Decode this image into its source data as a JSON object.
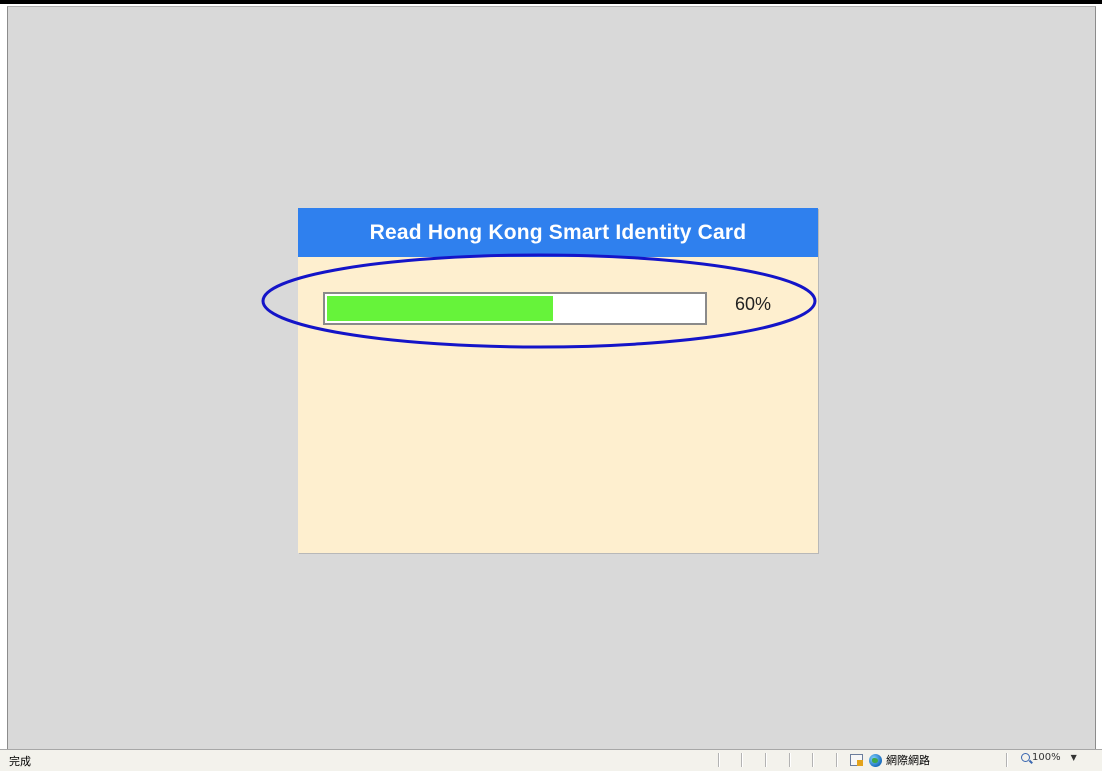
{
  "dialog": {
    "title": "Read Hong Kong Smart Identity Card",
    "progress_percent": 60,
    "progress_label": "60%"
  },
  "statusbar": {
    "status_text": "完成",
    "zone_label": "網際網路",
    "zoom_label": "100%",
    "icons": [
      "protected-mode-icon",
      "internet-zone-globe-icon",
      "zoom-icon",
      "zoom-dropdown-arrow-icon"
    ]
  },
  "colors": {
    "title_bar": "#2f80ee",
    "dialog_background": "#feefcf",
    "progress_fill": "#66f33a",
    "highlight_ellipse": "#1414c8",
    "page_background": "#d9d9d9"
  }
}
